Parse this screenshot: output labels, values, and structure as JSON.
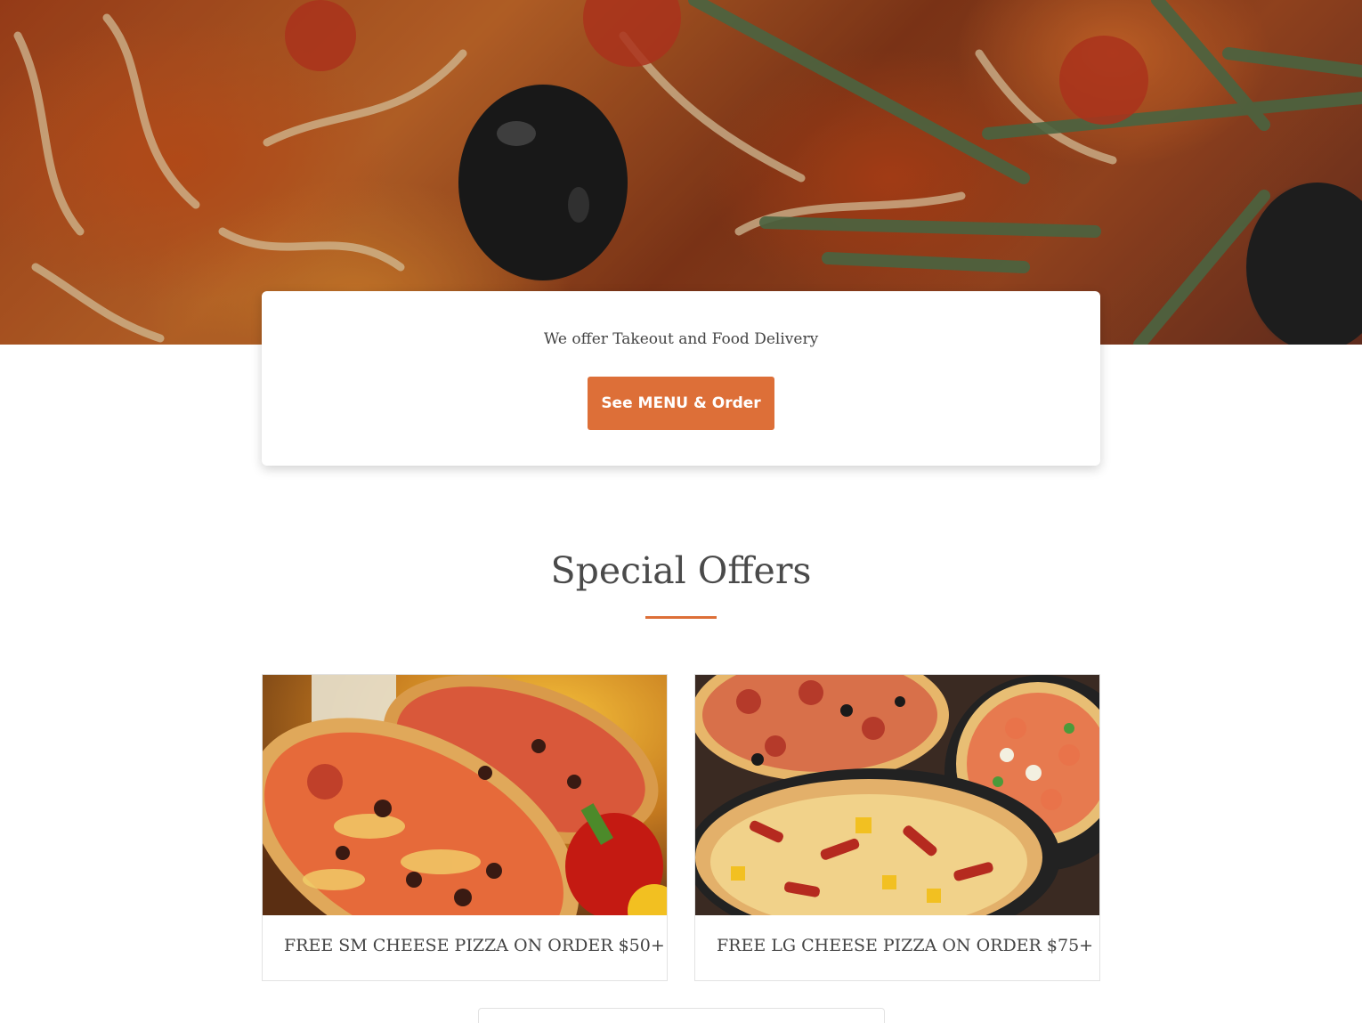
{
  "hero": {
    "image": "pizza-closeup-background",
    "tagline": "We offer Takeout and Food Delivery",
    "cta_label": "See MENU & Order"
  },
  "special_offers": {
    "title": "Special Offers",
    "offers": [
      {
        "image": "pizza-with-pepper-photo",
        "caption": "FREE SM CHEESE PIZZA ON ORDER $50+"
      },
      {
        "image": "assorted-pizzas-photo",
        "caption": "FREE LG CHEESE PIZZA ON ORDER $75+"
      }
    ]
  },
  "colors": {
    "accent": "#dd6f38",
    "text": "#444444",
    "card_border": "#e2e2e2",
    "background": "#ffffff"
  }
}
